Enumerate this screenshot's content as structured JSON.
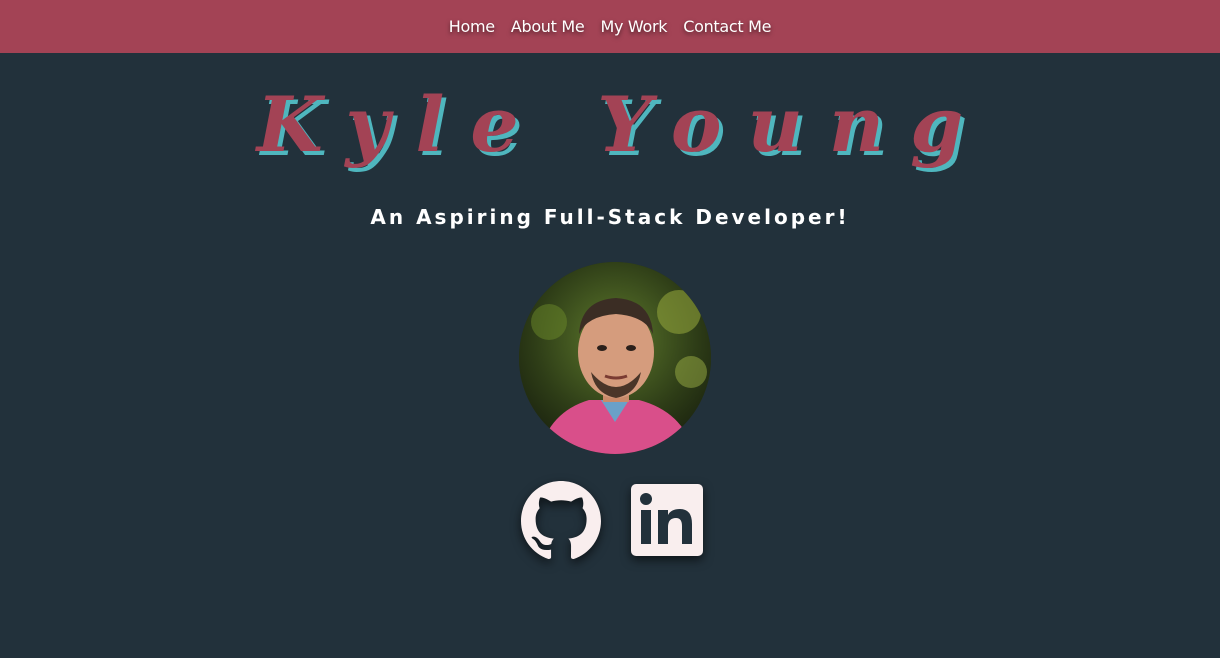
{
  "nav": {
    "items": [
      {
        "label": "Home"
      },
      {
        "label": "About Me"
      },
      {
        "label": "My Work"
      },
      {
        "label": "Contact Me"
      }
    ]
  },
  "hero": {
    "name": "Kyle Young",
    "tagline": "An Aspiring Full-Stack Developer!"
  },
  "avatar": {
    "alt": "Kyle Young profile photo"
  },
  "socials": [
    {
      "name": "github",
      "icon": "github-icon"
    },
    {
      "name": "linkedin",
      "icon": "linkedin-icon"
    }
  ],
  "colors": {
    "background": "#22313b",
    "navbar": "#a34355",
    "name": "#a34355",
    "name_shadow": "#4fb6be",
    "icon": "#f9eeee"
  }
}
